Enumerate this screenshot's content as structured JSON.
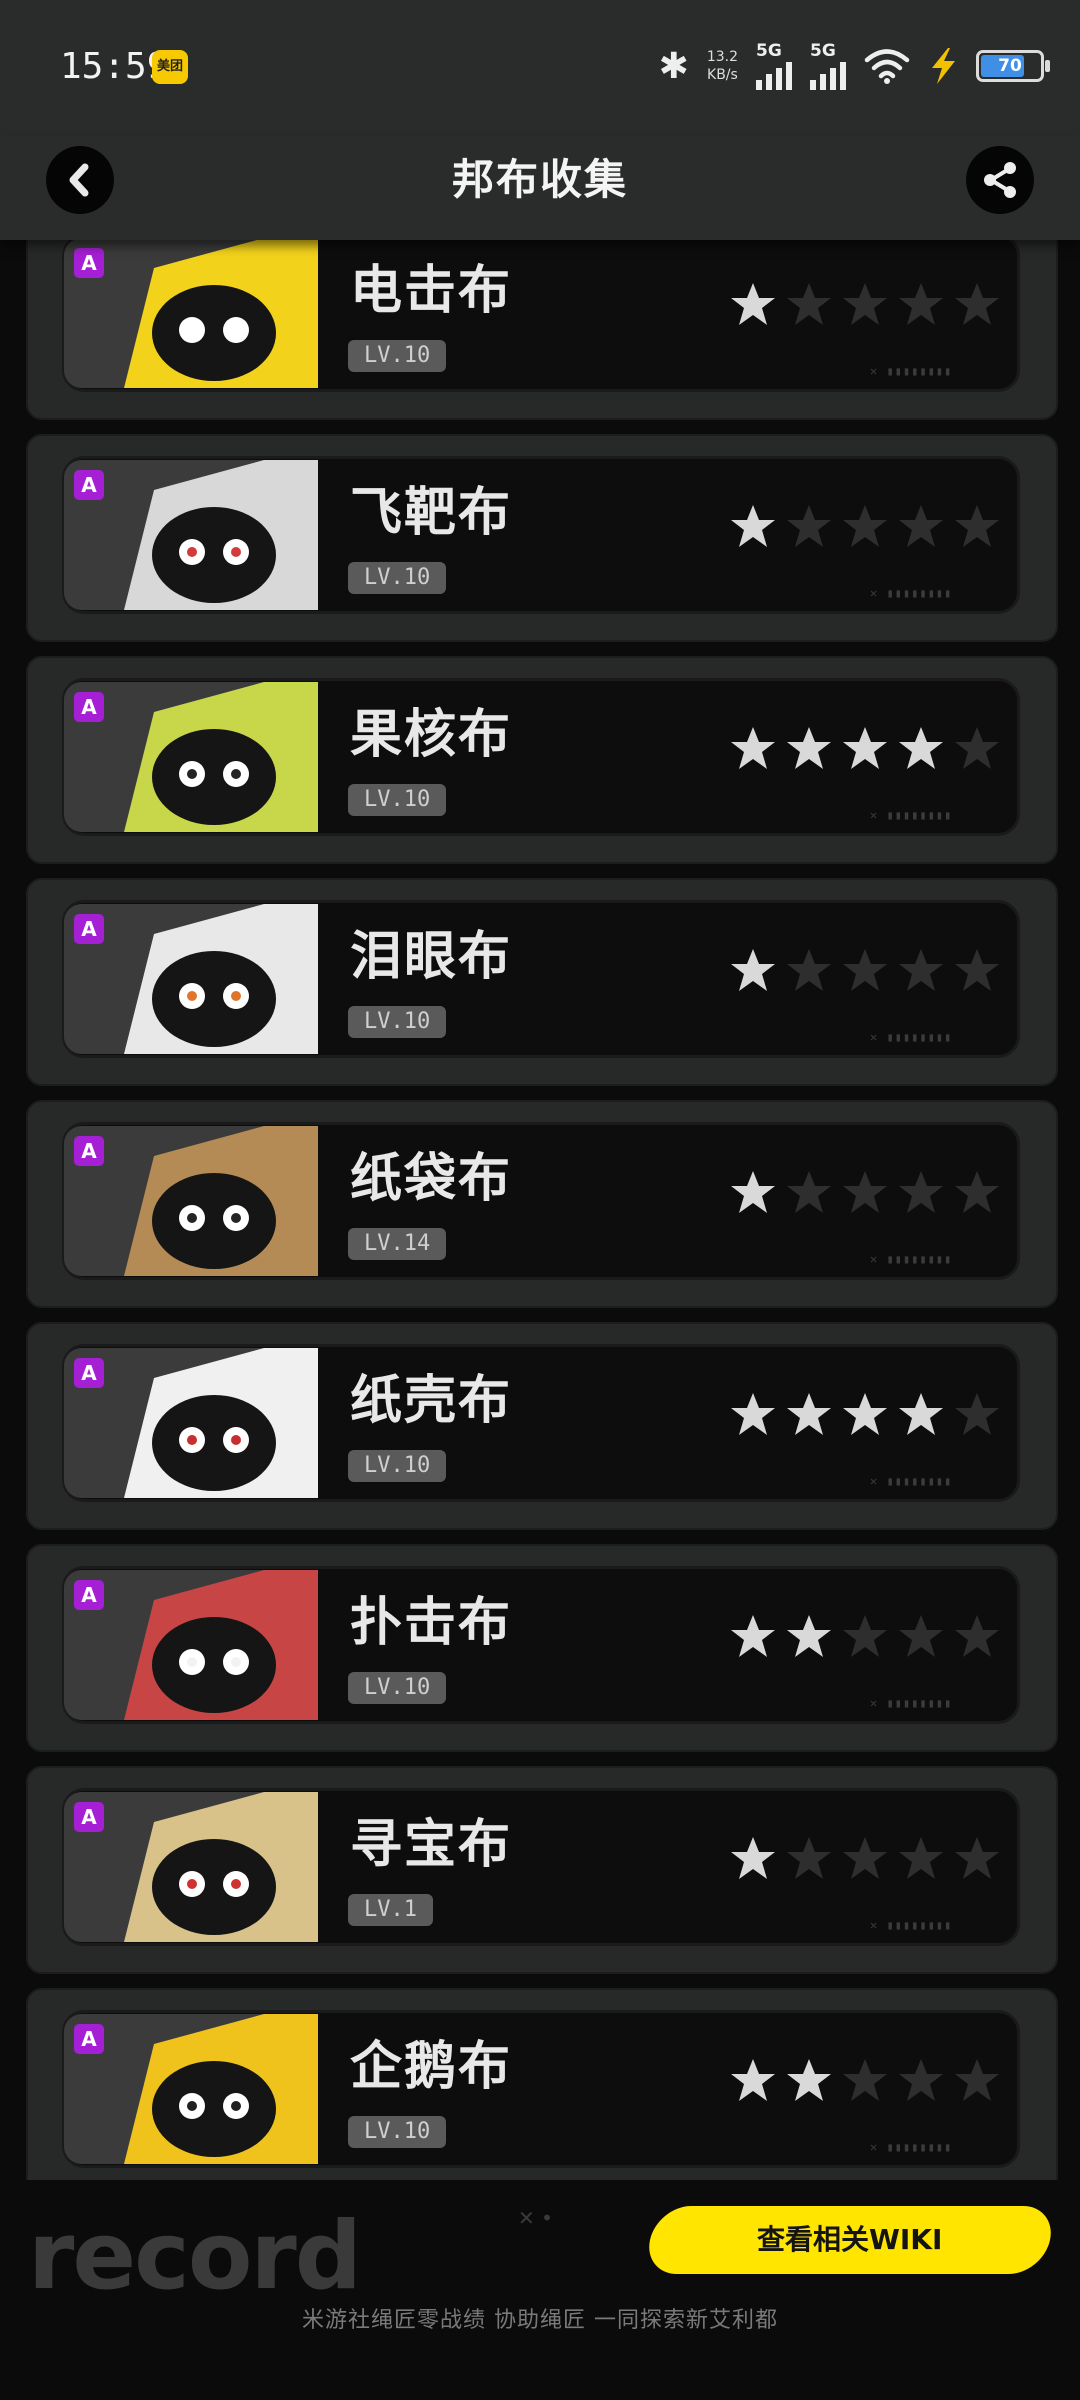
{
  "status_bar": {
    "time": "15:59",
    "app_badge": "美团",
    "net_speed_value": "13.2",
    "net_speed_unit": "KB/s",
    "signal_1_label": "5G",
    "signal_2_label": "5G",
    "battery_level": "70",
    "icons": [
      "bluetooth-icon",
      "signal-icon",
      "wifi-icon",
      "charging-bolt-icon",
      "battery-icon"
    ]
  },
  "header": {
    "title": "邦布收集",
    "back_icon": "chevron-left-icon",
    "share_icon": "share-icon"
  },
  "bangboos": [
    {
      "name": "电击布",
      "level": "LV.10",
      "stars": 1,
      "rank": "A"
    },
    {
      "name": "飞靶布",
      "level": "LV.10",
      "stars": 1,
      "rank": "A"
    },
    {
      "name": "果核布",
      "level": "LV.10",
      "stars": 4,
      "rank": "A"
    },
    {
      "name": "泪眼布",
      "level": "LV.10",
      "stars": 1,
      "rank": "A"
    },
    {
      "name": "纸袋布",
      "level": "LV.14",
      "stars": 1,
      "rank": "A"
    },
    {
      "name": "纸壳布",
      "level": "LV.10",
      "stars": 4,
      "rank": "A"
    },
    {
      "name": "扑击布",
      "level": "LV.10",
      "stars": 2,
      "rank": "A"
    },
    {
      "name": "寻宝布",
      "level": "LV.1",
      "stars": 1,
      "rank": "A"
    },
    {
      "name": "企鹅布",
      "level": "LV.10",
      "stars": 2,
      "rank": "A"
    }
  ],
  "card_code": "✕ ▮▮▮▮▮▮▮▮",
  "footer": {
    "logo": "record",
    "logo_mark": "✕ •",
    "wiki_button": "查看相关WIKI",
    "slogan": "米游社绳匠零战绩 协助绳匠 一同探索新艾利都"
  },
  "colors": {
    "accent_yellow": "#ffe500",
    "rank_purple": "#a51fd4",
    "star_on": "#d9d9d9",
    "star_off": "#2e2e2e"
  }
}
